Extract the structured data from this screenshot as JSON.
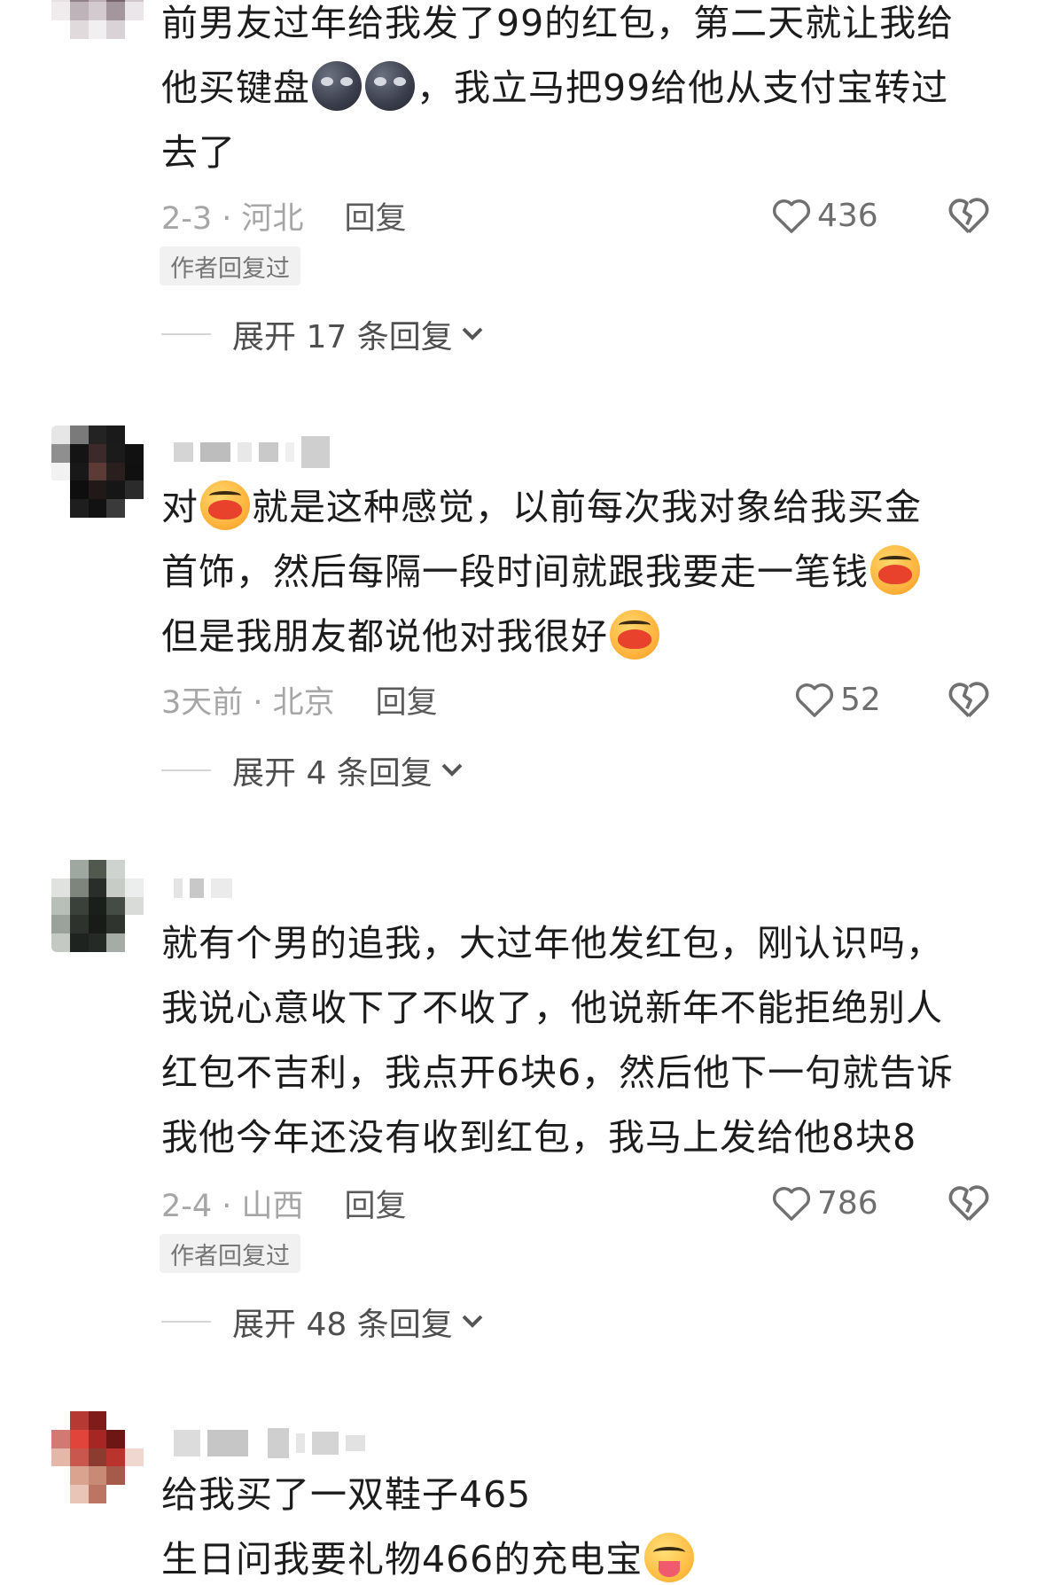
{
  "comments": [
    {
      "text_lines": [
        [
          "前男友过年给我发了99的红包，第二天就让我给"
        ],
        [
          "他买键盘",
          "[emoji]",
          "[emoji]",
          "，我立马把99给他从支付宝转过"
        ],
        [
          "去了"
        ]
      ],
      "date_location": "2-3 · 河北",
      "reply": "回复",
      "likes": "436",
      "author_tag": "作者回复过",
      "expand": "展开 17 条回复"
    },
    {
      "line1a": "对",
      "line1b": "就是这种感觉，以前每次我对象给我买金",
      "line2": "首饰，然后每隔一段时间就跟我要走一笔钱",
      "line3": "但是我朋友都说他对我很好",
      "date_location": "3天前 · 北京",
      "reply": "回复",
      "likes": "52",
      "expand": "展开 4 条回复"
    },
    {
      "line1": "就有个男的追我，大过年他发红包，刚认识吗，",
      "line2": "我说心意收下了不收了，他说新年不能拒绝别人",
      "line3": "红包不吉利，我点开6块6，然后他下一句就告诉",
      "line4": "我他今年还没有收到红包，我马上发给他8块8",
      "date_location": "2-4 · 山西",
      "reply": "回复",
      "likes": "786",
      "author_tag": "作者回复过",
      "expand": "展开 48 条回复"
    },
    {
      "line1": "给我买了一双鞋子465",
      "line2": "生日问我要礼物466的充电宝"
    }
  ],
  "c1": {
    "line1": "前男友过年给我发了99的红包，第二天就让我给",
    "line2a": "他买键盘",
    "line2b": "，我立马把99给他从支付宝转过",
    "line3": "去了"
  },
  "icons": {
    "like": "heart-outline-icon",
    "dislike": "broken-heart-icon",
    "expand": "chevron-down-icon"
  }
}
